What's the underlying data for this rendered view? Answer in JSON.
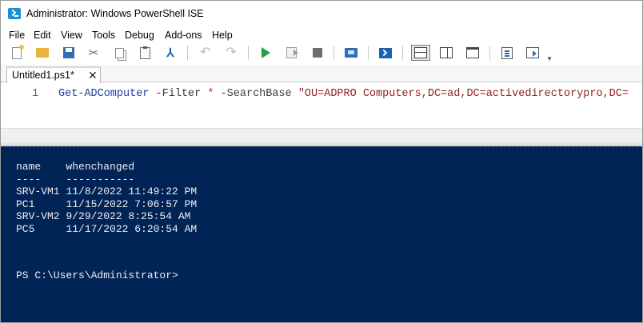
{
  "window": {
    "title": "Administrator: Windows PowerShell ISE"
  },
  "menu": [
    "File",
    "Edit",
    "View",
    "Tools",
    "Debug",
    "Add-ons",
    "Help"
  ],
  "toolbar": {
    "icons": [
      "new-file-icon",
      "open-folder-icon",
      "save-icon",
      "cut-icon",
      "copy-icon",
      "paste-icon",
      "command-icon",
      "undo-icon",
      "redo-icon",
      "run-script-icon",
      "run-selection-icon",
      "stop-icon",
      "remote-powershell-icon",
      "start-powershell-icon",
      "layout-script-top-icon",
      "layout-script-right-icon",
      "layout-script-maximized-icon",
      "show-command-icon",
      "show-addon-icon",
      "toolbar-overflow-icon"
    ]
  },
  "tabs": [
    {
      "label": "Untitled1.ps1*",
      "close": "✕"
    }
  ],
  "editor": {
    "line_number": "1",
    "tokens": {
      "cmdlet": "Get-ADComputer",
      "sp1": " ",
      "param1": "-Filter",
      "sp2": " ",
      "op": "*",
      "sp3": " ",
      "param2": "-SearchBase",
      "sp4": " ",
      "string": "\"OU=ADPRO Computers,DC=ad,DC=activedirectorypro,DC="
    }
  },
  "console": {
    "output": "name    whenchanged\n----    -----------\nSRV-VM1 11/8/2022 11:49:22 PM\nPC1     11/15/2022 7:06:57 PM\nSRV-VM2 9/29/2022 8:25:54 AM\nPC5     11/17/2022 6:20:54 AM",
    "prompt": "PS C:\\Users\\Administrator>"
  },
  "colors": {
    "console_bg": "#012456",
    "console_text": "#eeedf0",
    "cmdlet": "#1b3fa3",
    "string": "#8f1f1f",
    "line_number": "#2b7c94"
  }
}
